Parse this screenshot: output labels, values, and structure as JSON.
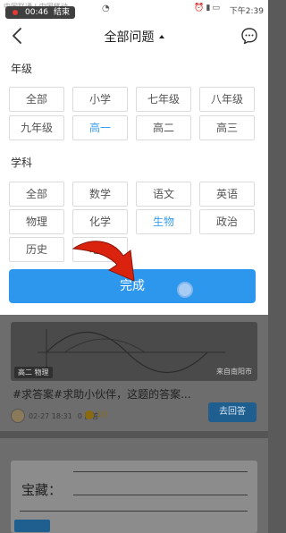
{
  "status_bar": {
    "carrier": "中国联通 | 中国移动",
    "recording_timer": "00:46",
    "recording_end": "结束",
    "clock": "下午2:39"
  },
  "header": {
    "title": "全部问题"
  },
  "grade": {
    "label": "年级",
    "options": [
      "全部",
      "小学",
      "七年级",
      "八年级",
      "九年级",
      "高一",
      "高二",
      "高三"
    ],
    "selected": "高一"
  },
  "subject": {
    "label": "学科",
    "options": [
      "全部",
      "数学",
      "语文",
      "英语",
      "物理",
      "化学",
      "生物",
      "政治",
      "历史",
      "地理"
    ],
    "selected": "生物"
  },
  "done_label": "完成",
  "feed": {
    "post1": {
      "image_tag": "高二 物理",
      "image_source": "来自南阳市",
      "title": "#求答案#求助小伙伴，这题的答案...",
      "date": "02-27 18:31",
      "answers": "0 回答",
      "reward": "10",
      "answer_button": "去回答"
    },
    "post2": {
      "image_text": "宝藏："
    }
  },
  "colors": {
    "accent": "#2d97ee",
    "selected_text": "#3a9ef0"
  }
}
